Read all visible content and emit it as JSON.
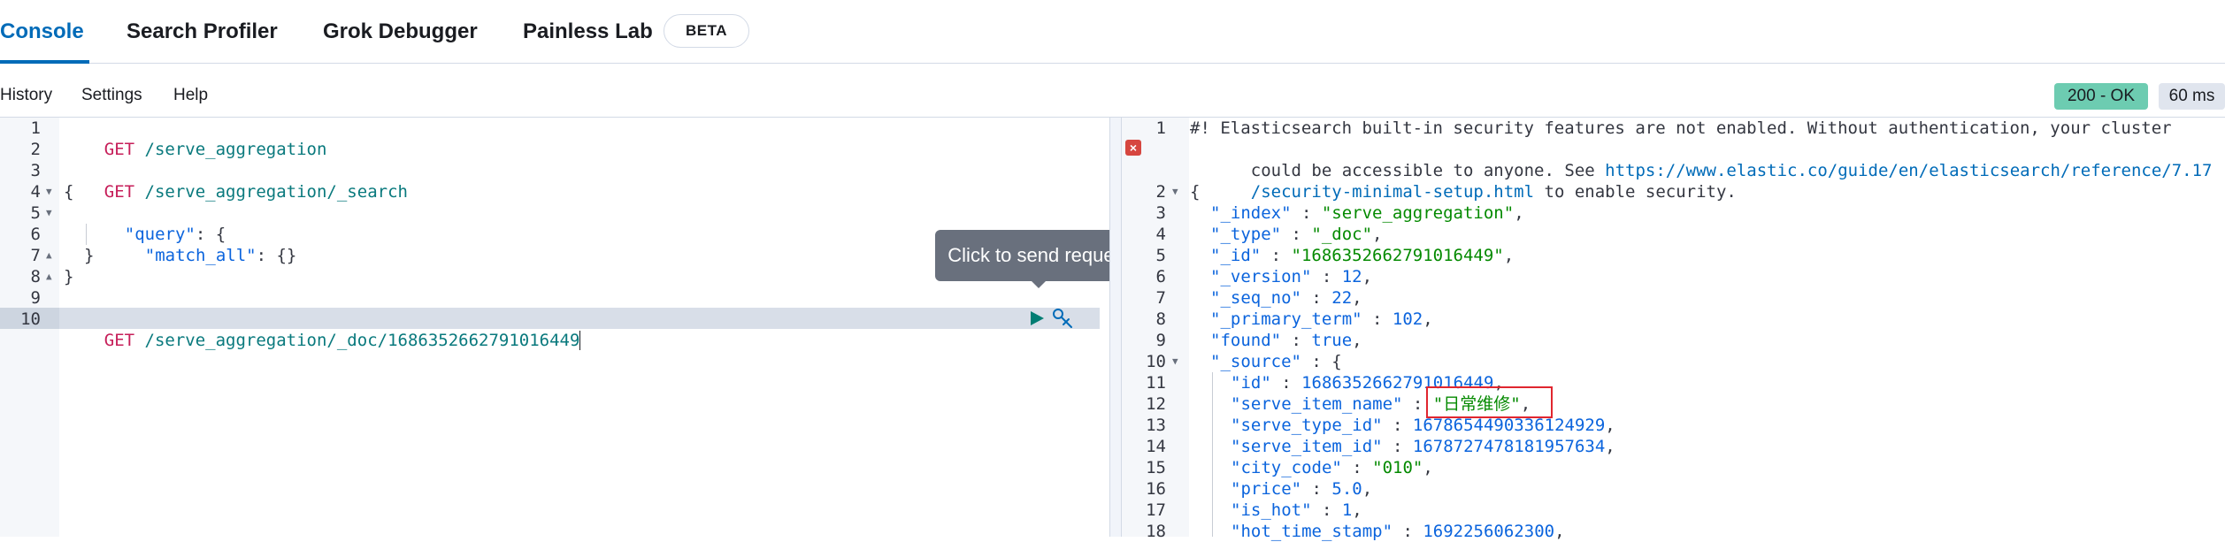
{
  "tabs": [
    {
      "label": "Console",
      "active": true
    },
    {
      "label": "Search Profiler",
      "active": false
    },
    {
      "label": "Grok Debugger",
      "active": false
    },
    {
      "label": "Painless Lab",
      "active": false
    }
  ],
  "beta_badge": "BETA",
  "toolbar": {
    "history": "History",
    "settings": "Settings",
    "help": "Help"
  },
  "status": {
    "code_label": "200 - OK",
    "time_label": "60 ms",
    "ok_color": "#6dccb1"
  },
  "tooltip": "Click to send request",
  "request": {
    "line_numbers": [
      "1",
      "2",
      "3",
      "4",
      "5",
      "6",
      "7",
      "8",
      "9",
      "10"
    ],
    "l1_method": "GET",
    "l1_path": " /serve_aggregation",
    "l3_method": "GET",
    "l3_path": " /serve_aggregation/_search",
    "l4": "{",
    "l5_key": "\"query\"",
    "l5_rest": ": {",
    "l6_key": "\"match_all\"",
    "l6_rest": ": {}",
    "l7": "}",
    "l8": "}",
    "l10_method": "GET",
    "l10_path": " /serve_aggregation/_doc/1686352662791016449"
  },
  "response": {
    "line_numbers": [
      "1",
      "",
      "",
      "2",
      "3",
      "4",
      "5",
      "6",
      "7",
      "8",
      "9",
      "10",
      "11",
      "12",
      "13",
      "14",
      "15",
      "16",
      "17",
      "18"
    ],
    "comment_1": "#! Elasticsearch built-in security features are not enabled. Without authentication, your cluster",
    "comment_2_pre": "could be accessible to anyone. See ",
    "comment_2_url": "https://www.elastic.co/guide/en/elasticsearch/reference/7.17",
    "comment_3_url": "/security-minimal-setup.html",
    "comment_3_post": " to enable security.",
    "open_brace": "{",
    "fields": [
      {
        "key": "\"_index\"",
        "value": "\"serve_aggregation\"",
        "type": "str"
      },
      {
        "key": "\"_type\"",
        "value": "\"_doc\"",
        "type": "str"
      },
      {
        "key": "\"_id\"",
        "value": "\"1686352662791016449\"",
        "type": "str"
      },
      {
        "key": "\"_version\"",
        "value": "12",
        "type": "num"
      },
      {
        "key": "\"_seq_no\"",
        "value": "22",
        "type": "num"
      },
      {
        "key": "\"_primary_term\"",
        "value": "102",
        "type": "num"
      },
      {
        "key": "\"found\"",
        "value": "true",
        "type": "num"
      },
      {
        "key": "\"_source\"",
        "value": "{",
        "type": "brace"
      },
      {
        "key": "\"id\"",
        "value": "1686352662791016449",
        "type": "num"
      },
      {
        "key": "\"serve_item_name\"",
        "value": "\"日常维修\"",
        "type": "str"
      },
      {
        "key": "\"serve_type_id\"",
        "value": "1678654490336124929",
        "type": "num"
      },
      {
        "key": "\"serve_item_id\"",
        "value": "1678727478181957634",
        "type": "num"
      },
      {
        "key": "\"city_code\"",
        "value": "\"010\"",
        "type": "str"
      },
      {
        "key": "\"price\"",
        "value": "5.0",
        "type": "num"
      },
      {
        "key": "\"is_hot\"",
        "value": "1",
        "type": "num"
      },
      {
        "key": "\"hot_time_stamp\"",
        "value": "1692256062300",
        "type": "num"
      }
    ]
  }
}
